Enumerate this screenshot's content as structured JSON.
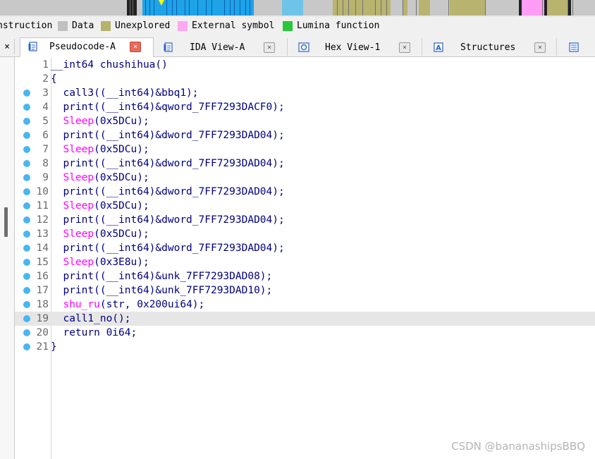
{
  "navband": {
    "colors": {
      "bg": "#c8c8c8",
      "regular": "#1ea3e8",
      "data": "#c0c0c0",
      "unexplored": "#b8b470",
      "external": "#ff9cf5",
      "library": "#6fc3e8",
      "dark": "#222222",
      "marker": "#ffff00"
    }
  },
  "legend": {
    "items": [
      {
        "label": "nstruction",
        "color": ""
      },
      {
        "label": "Data",
        "color": "#c0c0c0"
      },
      {
        "label": "Unexplored",
        "color": "#b5b26e"
      },
      {
        "label": "External symbol",
        "color": "#ffa8f2"
      },
      {
        "label": "Lumina function",
        "color": "#2bc63a"
      }
    ]
  },
  "tabs": [
    {
      "label": "Pseudocode-A",
      "icon": "pseudocode-icon",
      "active": true
    },
    {
      "label": "IDA View-A",
      "icon": "disassembly-icon",
      "active": false
    },
    {
      "label": "Hex View-1",
      "icon": "hex-view-icon",
      "active": false
    },
    {
      "label": "Structures",
      "icon": "structures-icon",
      "active": false
    },
    {
      "label": "",
      "icon": "enums-icon",
      "active": false
    }
  ],
  "tab_close_glyph": "×",
  "left_close_glyph": "×",
  "code": {
    "current_line": 19,
    "lines": [
      {
        "n": "1",
        "bp": false,
        "text": "__int64 chushihua()"
      },
      {
        "n": "2",
        "bp": false,
        "text": "{"
      },
      {
        "n": "3",
        "bp": true,
        "text": "  call3((__int64)&bbq1);"
      },
      {
        "n": "4",
        "bp": true,
        "text": "  print((__int64)&qword_7FF7293DACF0);"
      },
      {
        "n": "5",
        "bp": true,
        "text": "  Sleep(0x5DCu);"
      },
      {
        "n": "6",
        "bp": true,
        "text": "  print((__int64)&dword_7FF7293DAD04);"
      },
      {
        "n": "7",
        "bp": true,
        "text": "  Sleep(0x5DCu);"
      },
      {
        "n": "8",
        "bp": true,
        "text": "  print((__int64)&dword_7FF7293DAD04);"
      },
      {
        "n": "9",
        "bp": true,
        "text": "  Sleep(0x5DCu);"
      },
      {
        "n": "10",
        "bp": true,
        "text": "  print((__int64)&dword_7FF7293DAD04);"
      },
      {
        "n": "11",
        "bp": true,
        "text": "  Sleep(0x5DCu);"
      },
      {
        "n": "12",
        "bp": true,
        "text": "  print((__int64)&dword_7FF7293DAD04);"
      },
      {
        "n": "13",
        "bp": true,
        "text": "  Sleep(0x5DCu);"
      },
      {
        "n": "14",
        "bp": true,
        "text": "  print((__int64)&dword_7FF7293DAD04);"
      },
      {
        "n": "15",
        "bp": true,
        "text": "  Sleep(0x3E8u);"
      },
      {
        "n": "16",
        "bp": true,
        "text": "  print((__int64)&unk_7FF7293DAD08);"
      },
      {
        "n": "17",
        "bp": true,
        "text": "  print((__int64)&unk_7FF7293DAD10);"
      },
      {
        "n": "18",
        "bp": true,
        "text": "  shu_ru(str, 0x200ui64);"
      },
      {
        "n": "19",
        "bp": true,
        "text": "  call1_no();"
      },
      {
        "n": "20",
        "bp": true,
        "text": "  return 0i64;"
      },
      {
        "n": "21",
        "bp": true,
        "text": "}"
      }
    ],
    "colors": {
      "default": "#000080",
      "import": "#ff00ff",
      "linenum": "#6a6a6a",
      "breakpoint": "#49b6f0"
    }
  },
  "watermark": "CSDN @bananashipsBBQ"
}
